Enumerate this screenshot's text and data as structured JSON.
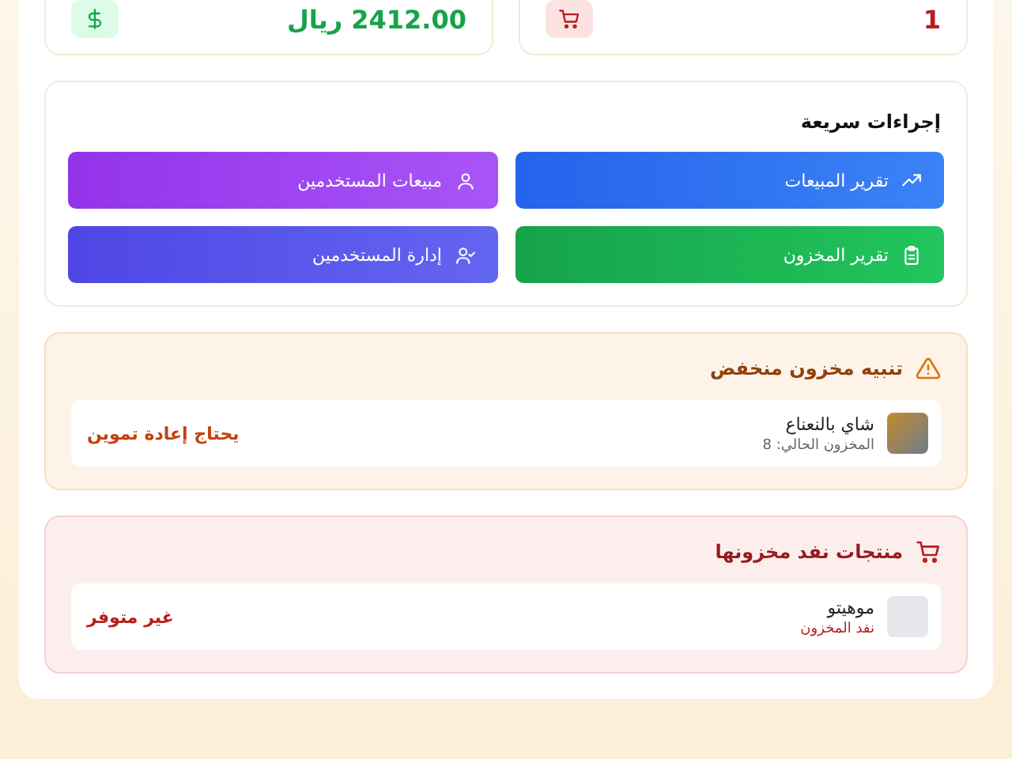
{
  "stats": [
    {
      "value": "1",
      "color": "#b91c1c",
      "kind": "cart"
    },
    {
      "value": "2412.00 ريال",
      "color": "#16a34a",
      "kind": "money"
    }
  ],
  "quick_actions": {
    "title": "إجراءات سريعة",
    "buttons": [
      {
        "label": "تقرير المبيعات",
        "kind": "sales_report"
      },
      {
        "label": "مبيعات المستخدمين",
        "kind": "user_sales"
      },
      {
        "label": "تقرير المخزون",
        "kind": "inventory_report"
      },
      {
        "label": "إدارة المستخدمين",
        "kind": "manage_users"
      }
    ]
  },
  "alerts": [
    {
      "kind": "low_stock",
      "title": "تنبيه مخزون منخفض",
      "items": [
        {
          "name": "شاي بالنعناع",
          "detail": "المخزون الحالي: 8",
          "status": "يحتاج إعادة تموين"
        }
      ]
    },
    {
      "kind": "out_of_stock",
      "title": "منتجات نفد مخزونها",
      "items": [
        {
          "name": "موهيتو",
          "detail": "نفد المخزون",
          "status": "غير متوفر"
        }
      ]
    }
  ]
}
